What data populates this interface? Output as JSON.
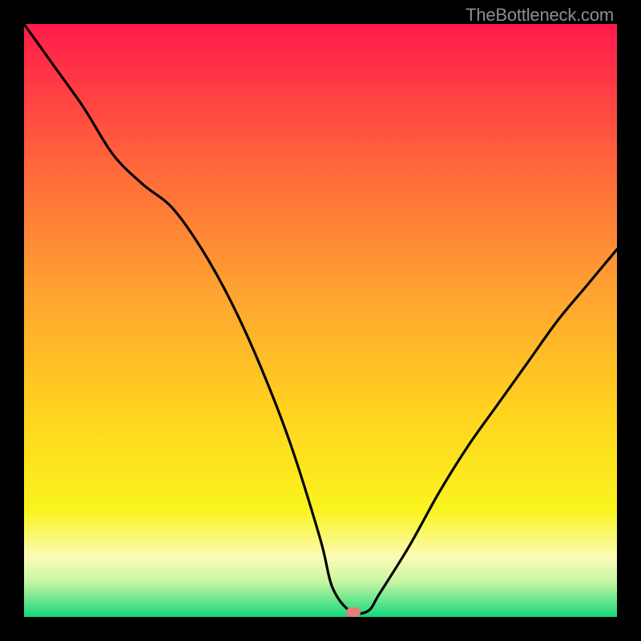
{
  "watermark": "TheBottleneck.com",
  "colors": {
    "frame": "#000000",
    "curve_stroke": "#000000",
    "marker": "#e77c7a",
    "watermark_text": "#8e8e8e",
    "gradient_stops": [
      {
        "offset": 0.0,
        "color": "#ff1a4b"
      },
      {
        "offset": 0.25,
        "color": "#ff6a3a"
      },
      {
        "offset": 0.45,
        "color": "#ffa231"
      },
      {
        "offset": 0.65,
        "color": "#ffd21f"
      },
      {
        "offset": 0.82,
        "color": "#faf41e"
      },
      {
        "offset": 0.9,
        "color": "#fbfbb8"
      },
      {
        "offset": 0.94,
        "color": "#c8f6a2"
      },
      {
        "offset": 0.97,
        "color": "#6fe78f"
      },
      {
        "offset": 1.0,
        "color": "#12d87e"
      }
    ]
  },
  "chart_data": {
    "type": "line",
    "title": "",
    "xlabel": "",
    "ylabel": "",
    "ylim": [
      0,
      100
    ],
    "xlim": [
      0,
      100
    ],
    "legend": [],
    "marker": {
      "x": 55.5,
      "y": 0.8
    },
    "series": [
      {
        "name": "bottleneck-curve",
        "x": [
          0,
          5,
          10,
          15,
          20,
          25,
          30,
          35,
          40,
          45,
          50,
          52,
          55,
          58,
          60,
          65,
          70,
          75,
          80,
          85,
          90,
          95,
          100
        ],
        "y": [
          100,
          93,
          86,
          78,
          73,
          69,
          62,
          53,
          42,
          29,
          13,
          5,
          1,
          1,
          4,
          12,
          21,
          29,
          36,
          43,
          50,
          56,
          62
        ]
      }
    ]
  }
}
